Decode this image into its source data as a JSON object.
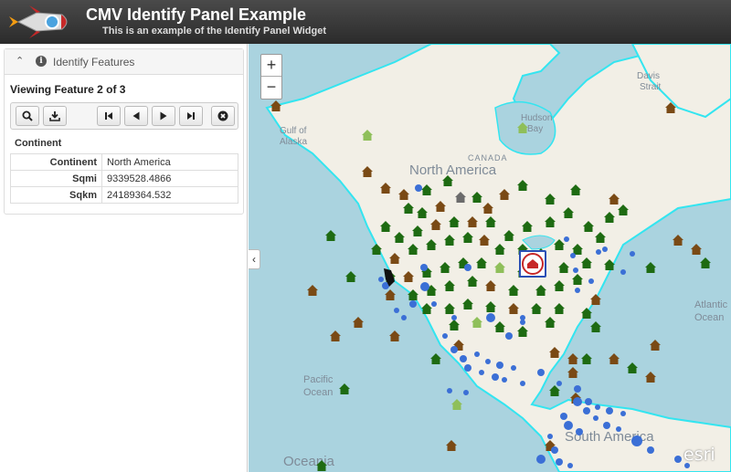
{
  "header": {
    "title": "CMV Identify Panel Example",
    "subtitle": "This is an example of the Identify Panel Widget"
  },
  "panel": {
    "title": "Identify Features",
    "viewing": "Viewing Feature 2 of 3",
    "section": "Continent",
    "attributes": [
      {
        "key": "Continent",
        "value": "North America"
      },
      {
        "key": "Sqmi",
        "value": "9339528.4866"
      },
      {
        "key": "Sqkm",
        "value": "24189364.532"
      }
    ]
  },
  "map": {
    "zoom_in": "+",
    "zoom_out": "−",
    "labels": {
      "hudson": "Hudson",
      "bay": "Bay",
      "davis": "Davis",
      "strait": "Strait",
      "gulf_of": "Gulf of",
      "alaska": "Alaska",
      "canada": "CANADA",
      "north_america": "North America",
      "atlantic": "Atlantic",
      "ocean_right": "Ocean",
      "pacific": "Pacific",
      "ocean_left": "Ocean",
      "south_america": "South America",
      "oceania": "Oceania"
    },
    "attribution": "esri"
  },
  "colors": {
    "header_bg": "#333333",
    "ocean": "#aad3df",
    "land": "#f2efe6",
    "coast": "#33e5f0",
    "house_green": "#1e6b12",
    "house_brown": "#7a4a15",
    "house_light_green": "#8fbf5a",
    "house_gray": "#6b6b6b",
    "dot_blue": "#3b6fd6"
  }
}
